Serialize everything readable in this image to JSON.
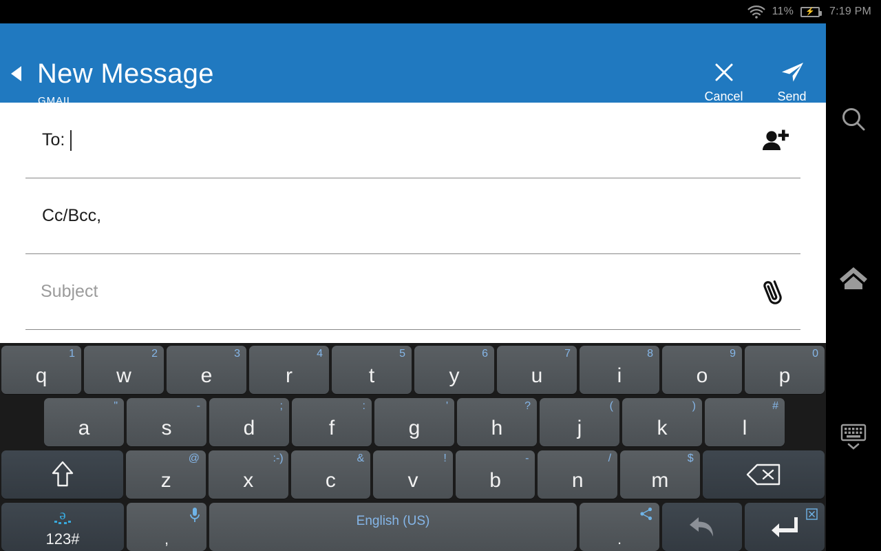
{
  "status_bar": {
    "wifi_icon": "wifi-icon",
    "battery_percent": "11%",
    "battery_icon": "battery-charging-icon",
    "time": "7:19 PM"
  },
  "header": {
    "back_icon": "back-triangle-icon",
    "title": "New Message",
    "subtitle": "GMAIL",
    "accent_color": "#2079c0",
    "actions": [
      {
        "label": "Cancel",
        "icon": "close-icon"
      },
      {
        "label": "Send",
        "icon": "send-paper-plane-icon"
      }
    ]
  },
  "compose": {
    "to": {
      "label": "To:",
      "value": "",
      "icon": "add-contact-icon"
    },
    "cc_bcc": {
      "label": "Cc/Bcc,"
    },
    "subject": {
      "placeholder": "Subject",
      "value": "",
      "icon": "attachment-paperclip-icon"
    }
  },
  "sidebar": {
    "items": [
      {
        "name": "search",
        "icon": "search-icon"
      },
      {
        "name": "home",
        "icon": "home-icon"
      },
      {
        "name": "hide-keyboard",
        "icon": "keyboard-hide-icon"
      }
    ]
  },
  "keyboard": {
    "language_label": "English (US)",
    "symbol_key_label": "123#",
    "row1": [
      {
        "main": "q",
        "sec": "1"
      },
      {
        "main": "w",
        "sec": "2"
      },
      {
        "main": "e",
        "sec": "3"
      },
      {
        "main": "r",
        "sec": "4"
      },
      {
        "main": "t",
        "sec": "5"
      },
      {
        "main": "y",
        "sec": "6"
      },
      {
        "main": "u",
        "sec": "7"
      },
      {
        "main": "i",
        "sec": "8"
      },
      {
        "main": "o",
        "sec": "9"
      },
      {
        "main": "p",
        "sec": "0"
      }
    ],
    "row2": [
      {
        "main": "a",
        "sec": "\""
      },
      {
        "main": "s",
        "sec": "-"
      },
      {
        "main": "d",
        "sec": ";"
      },
      {
        "main": "f",
        "sec": ":"
      },
      {
        "main": "g",
        "sec": "'"
      },
      {
        "main": "h",
        "sec": "?"
      },
      {
        "main": "j",
        "sec": "("
      },
      {
        "main": "k",
        "sec": ")"
      },
      {
        "main": "l",
        "sec": "#"
      }
    ],
    "row3": [
      {
        "main": "z",
        "sec": "@"
      },
      {
        "main": "x",
        "sec": ":-)"
      },
      {
        "main": "c",
        "sec": "&"
      },
      {
        "main": "v",
        "sec": "!"
      },
      {
        "main": "b",
        "sec": "-"
      },
      {
        "main": "n",
        "sec": "/"
      },
      {
        "main": "m",
        "sec": "$"
      }
    ],
    "shift_icon": "shift-up-arrow-icon",
    "backspace_icon": "backspace-delete-icon",
    "mic_icon": "microphone-icon",
    "comma_label": ",",
    "period_label": ".",
    "share_icon": "share-icon",
    "undo_icon": "undo-arrow-icon",
    "enter_icon": "enter-return-icon",
    "enter_corner_icon": "clear-text-icon",
    "settings_glyph_icon": "accent-a-settings-icon"
  }
}
